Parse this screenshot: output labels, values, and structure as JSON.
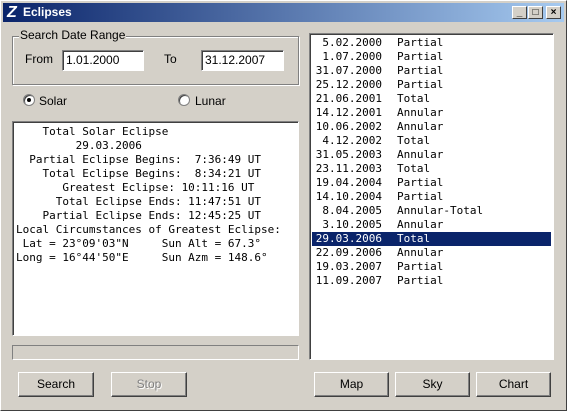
{
  "window": {
    "title": "Eclipses",
    "app_icon": "Z",
    "controls": {
      "minimize": "_",
      "maximize": "□",
      "close": "×"
    }
  },
  "search": {
    "group_title": "Search Date Range",
    "from_label": "From",
    "from_value": "1.01.2000",
    "to_label": "To",
    "to_value": "31.12.2007"
  },
  "mode": {
    "solar_label": "Solar",
    "lunar_label": "Lunar",
    "selected": "Solar"
  },
  "details": {
    "lines": [
      "    Total Solar Eclipse",
      "         29.03.2006",
      "  Partial Eclipse Begins:  7:36:49 UT",
      "    Total Eclipse Begins:  8:34:21 UT",
      "       Greatest Eclipse: 10:11:16 UT",
      "      Total Eclipse Ends: 11:47:51 UT",
      "    Partial Eclipse Ends: 12:45:25 UT",
      "Local Circumstances of Greatest Eclipse:",
      " Lat = 23°09'03\"N     Sun Alt = 67.3°",
      "Long = 16°44'50\"E     Sun Azm = 148.6°"
    ]
  },
  "eclipses": [
    {
      "date": "5.02.2000",
      "type": "Partial"
    },
    {
      "date": "1.07.2000",
      "type": "Partial"
    },
    {
      "date": "31.07.2000",
      "type": "Partial"
    },
    {
      "date": "25.12.2000",
      "type": "Partial"
    },
    {
      "date": "21.06.2001",
      "type": "Total"
    },
    {
      "date": "14.12.2001",
      "type": "Annular"
    },
    {
      "date": "10.06.2002",
      "type": "Annular"
    },
    {
      "date": "4.12.2002",
      "type": "Total"
    },
    {
      "date": "31.05.2003",
      "type": "Annular"
    },
    {
      "date": "23.11.2003",
      "type": "Total"
    },
    {
      "date": "19.04.2004",
      "type": "Partial"
    },
    {
      "date": "14.10.2004",
      "type": "Partial"
    },
    {
      "date": "8.04.2005",
      "type": "Annular-Total"
    },
    {
      "date": "3.10.2005",
      "type": "Annular"
    },
    {
      "date": "29.03.2006",
      "type": "Total"
    },
    {
      "date": "22.09.2006",
      "type": "Annular"
    },
    {
      "date": "19.03.2007",
      "type": "Partial"
    },
    {
      "date": "11.09.2007",
      "type": "Partial"
    }
  ],
  "selected_eclipse": "29.03.2006",
  "buttons": {
    "search": "Search",
    "stop": "Stop",
    "map": "Map",
    "sky": "Sky",
    "chart": "Chart"
  },
  "colors": {
    "selection": "#0a246a",
    "title_gradient_start": "#0a246a",
    "title_gradient_end": "#a6caf0",
    "face": "#d4d0c8"
  }
}
